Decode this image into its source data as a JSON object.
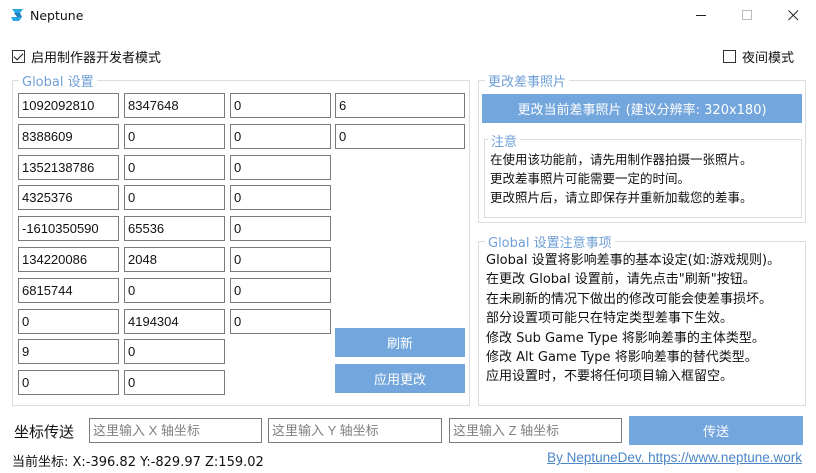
{
  "window": {
    "title": "Neptune"
  },
  "options": {
    "dev_mode_label": "启用制作器开发者模式",
    "dev_mode_checked": true,
    "night_mode_label": "夜间模式",
    "night_mode_checked": false
  },
  "global_settings": {
    "title": "Global 设置",
    "rows": [
      [
        "1092092810",
        "8347648",
        "0",
        "6"
      ],
      [
        "8388609",
        "0",
        "0",
        "0"
      ],
      [
        "1352138786",
        "0",
        "0"
      ],
      [
        "4325376",
        "0",
        "0"
      ],
      [
        "-1610350590",
        "65536",
        "0"
      ],
      [
        "134220086",
        "2048",
        "0"
      ],
      [
        "6815744",
        "0",
        "0"
      ],
      [
        "0",
        "4194304",
        "0"
      ],
      [
        "9",
        "0"
      ],
      [
        "0",
        "0"
      ]
    ],
    "refresh_label": "刷新",
    "apply_label": "应用更改"
  },
  "photo": {
    "title": "更改差事照片",
    "button_label": "更改当前差事照片 (建议分辨率: 320x180)",
    "note_title": "注意",
    "note_lines": [
      "在使用该功能前，请先用制作器拍摄一张照片。",
      "更改差事照片可能需要一定的时间。",
      "更改照片后，请立即保存并重新加载您的差事。"
    ]
  },
  "global_notes": {
    "title": "Global 设置注意事项",
    "lines": [
      "Global 设置将影响差事的基本设定(如:游戏规则)。",
      "在更改 Global 设置前，请先点击\"刷新\"按钮。",
      "在未刷新的情况下做出的修改可能会使差事损坏。",
      "部分设置项可能只在特定类型差事下生效。",
      "修改 Sub Game Type 将影响差事的主体类型。",
      "修改 Alt Game Type 将影响差事的替代类型。",
      "应用设置时，不要将任何项目输入框留空。"
    ]
  },
  "teleport": {
    "label": "坐标传送",
    "x_placeholder": "这里输入 X 轴坐标",
    "y_placeholder": "这里输入 Y 轴坐标",
    "z_placeholder": "这里输入 Z 轴坐标",
    "button_label": "传送"
  },
  "status": {
    "coords": "当前坐标:  X:-396.82 Y:-829.97 Z:159.02",
    "link": "By NeptuneDev. https://www.neptune.work"
  },
  "colors": {
    "accent": "#73a6dc",
    "group_title": "#6e9fd6",
    "link": "#4a86c8"
  }
}
